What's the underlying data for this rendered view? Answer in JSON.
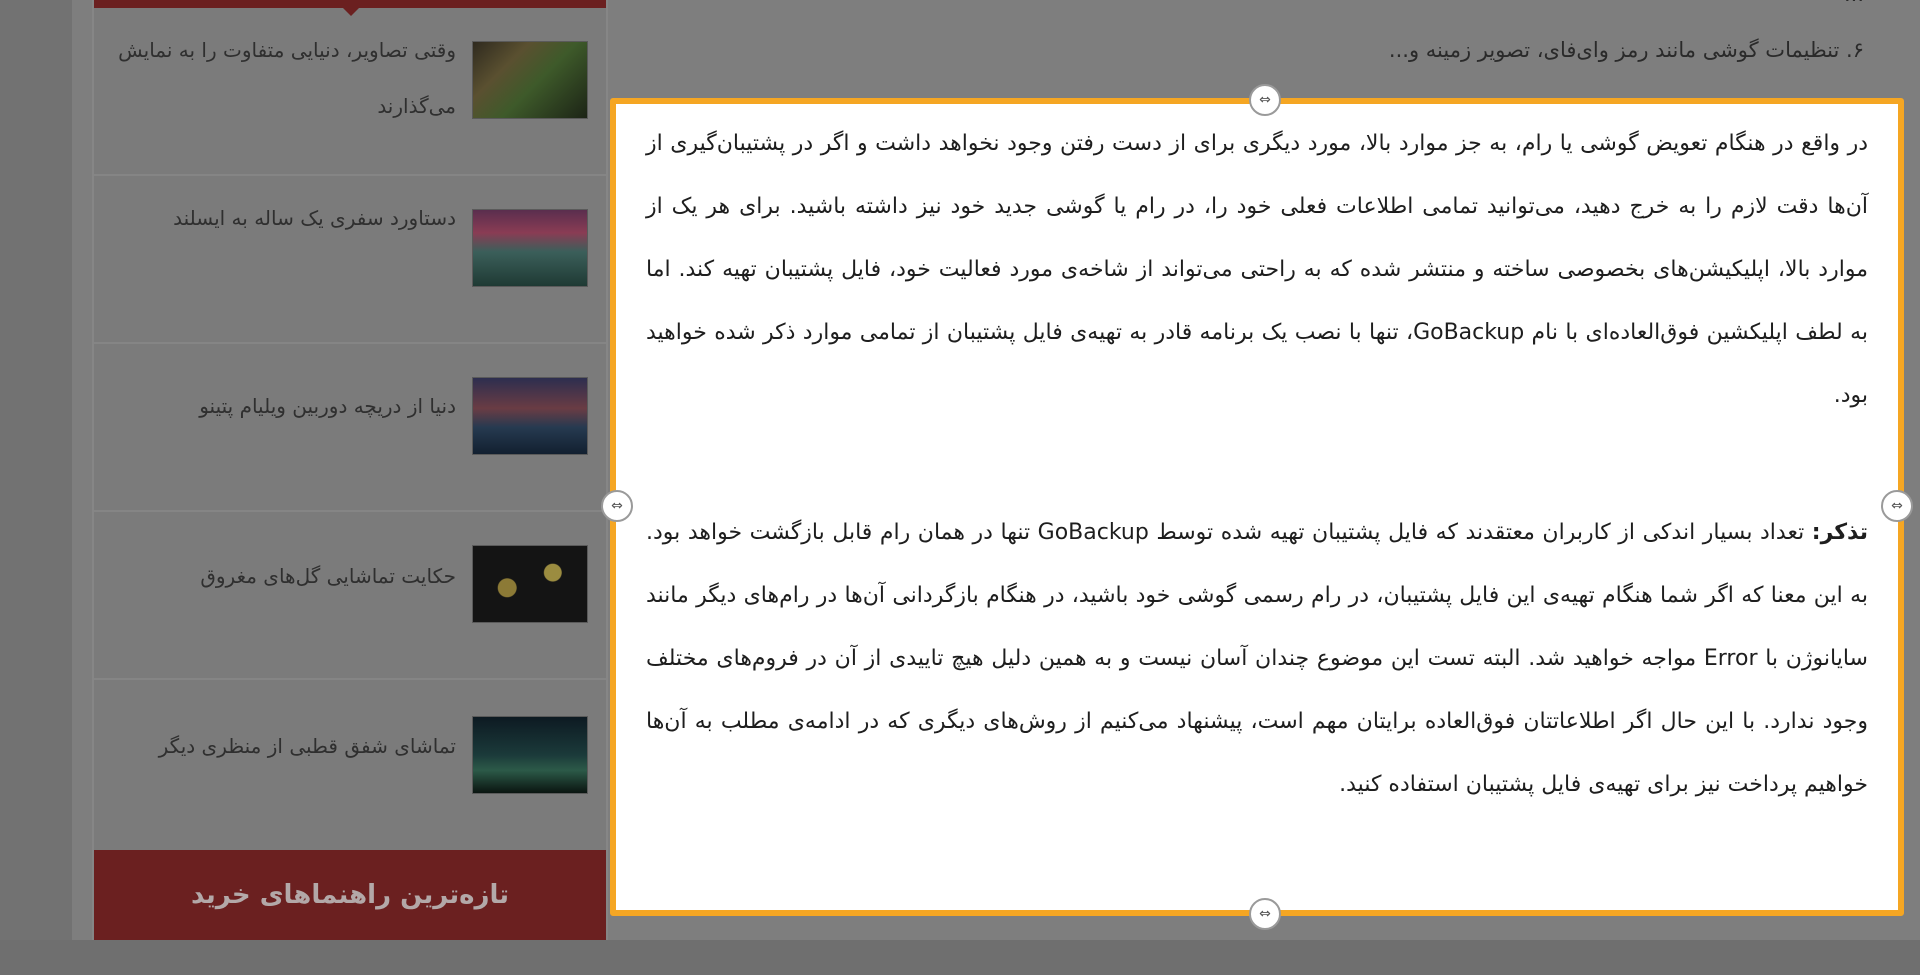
{
  "sidebar": {
    "items": [
      {
        "title": "وقتی تصاویر، دنیایی متفاوت را به نمایش می‌گذارند",
        "thumb_icon": "landscape-photo-icon"
      },
      {
        "title": "دستاورد سفری یک ساله به ایسلند",
        "thumb_icon": "landscape-photo-icon"
      },
      {
        "title": "دنیا از دریچه دوربین ویلیام پتینو",
        "thumb_icon": "landscape-photo-icon"
      },
      {
        "title": "حکایت تماشایی گل‌های مغروق",
        "thumb_icon": "flower-photo-icon"
      },
      {
        "title": "تماشای شفق قطبی از منظری دیگر",
        "thumb_icon": "aurora-photo-icon"
      }
    ],
    "footer_title": "تازه‌ترین راهنماهای خرید"
  },
  "article": {
    "pre_line_top": "...",
    "pre_line": "۶. تنظیمات گوشی مانند رمز وای‌فای، تصویر زمینه و...",
    "paragraph1": "در واقع در هنگام تعویض گوشی یا رام، به جز موارد بالا، مورد دیگری برای از دست رفتن وجود نخواهد داشت و اگر در پشتیبان‌گیری از آن‌ها دقت لازم را به خرج دهید، می‌توانید تمامی اطلاعات فعلی خود را، در رام یا گوشی جدید خود نیز داشته باشید. برای هر یک از موارد بالا، اپلیکیشن‌های بخصوصی ساخته و منتشر شده که به راحتی می‌تواند از شاخه‌ی مورد فعالیت خود، فایل پشتیبان تهیه کند. اما به لطف اپلیکشین فوق‌العاده‌ای با نام GoBackup، تنها با نصب یک برنامه قادر به تهیه‌ی فایل پشتیبان از تمامی موارد ذکر شده خواهید بود.",
    "note_label": "تذکر:",
    "paragraph2": " تعداد بسیار اندکی از کاربران معتقدند که فایل پشتیبان تهیه شده توسط GoBackup تنها در همان رام قابل بازگشت خواهد بود. به این معنا که اگر شما هنگام تهیه‌ی این فایل پشتیبان، در رام رسمی گوشی خود باشید، در هنگام بازگردانی آن‌ها در رام‌های دیگر مانند سایانوژن با Error مواجه خواهید شد. البته تست این موضوع چندان آسان نیست و به همین دلیل هیچ تاییدی از آن در فروم‌های مختلف وجود ندارد. با این حال اگر اطلاعاتتان فوق‌العاده برایتان مهم است، پیشنهاد می‌کنیم از روش‌های دیگری که در ادامه‌ی مطلب به آن‌ها خواهیم پرداخت نیز برای تهیه‌ی فایل پشتیبان استفاده کنید."
  },
  "colors": {
    "highlight_border": "#f5a623",
    "sidebar_accent": "#6b2020"
  },
  "handles": {
    "top_icon": "resize-handle-icon",
    "left_icon": "resize-handle-icon",
    "right_icon": "resize-handle-icon",
    "bottom_icon": "resize-handle-icon"
  }
}
